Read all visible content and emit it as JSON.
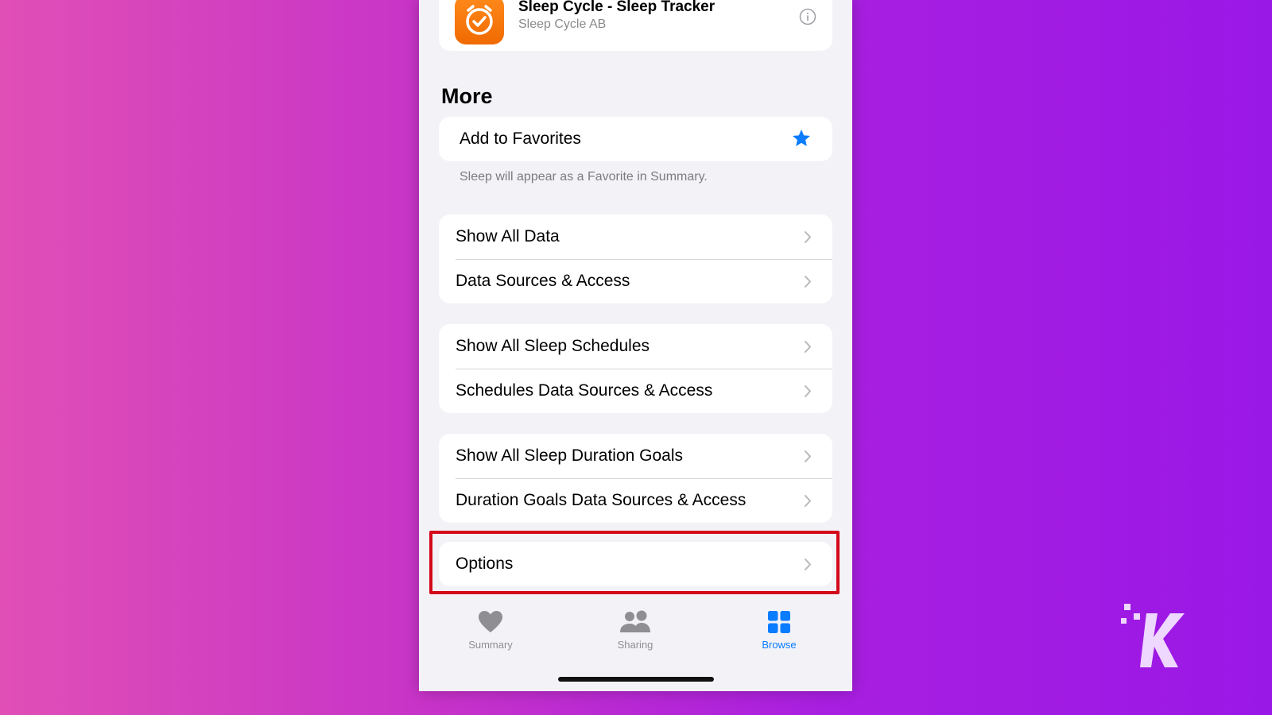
{
  "app": {
    "name": "Sleep Cycle - Sleep Tracker",
    "developer": "Sleep Cycle AB",
    "icon": "alarm-check-icon"
  },
  "more": {
    "title": "More",
    "favorite": {
      "label": "Add to Favorites",
      "icon": "star-icon",
      "note": "Sleep will appear as a Favorite in Summary."
    },
    "groups": [
      [
        "Show All Data",
        "Data Sources & Access"
      ],
      [
        "Show All Sleep Schedules",
        "Schedules Data Sources & Access"
      ],
      [
        "Show All Sleep Duration Goals",
        "Duration Goals Data Sources & Access"
      ],
      [
        "Options"
      ]
    ]
  },
  "tabs": [
    {
      "label": "Summary",
      "icon": "heart-icon",
      "active": false
    },
    {
      "label": "Sharing",
      "icon": "people-icon",
      "active": false
    },
    {
      "label": "Browse",
      "icon": "grid-icon",
      "active": true
    }
  ],
  "colors": {
    "accent": "#0a7cff",
    "highlight": "#d40a1a",
    "app_icon": "#f27a00"
  }
}
